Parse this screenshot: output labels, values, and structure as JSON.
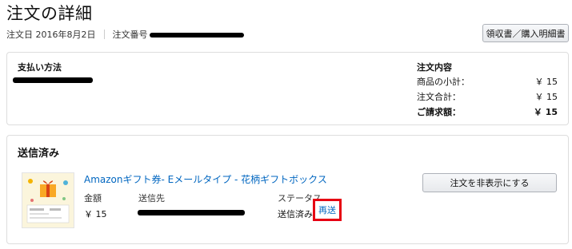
{
  "page": {
    "title": "注文の詳細",
    "order_date": "注文日 2016年8月2日",
    "order_number_label": "注文番号"
  },
  "buttons": {
    "receipt": "領収書／購入明細書",
    "hide_order": "注文を非表示にする",
    "resend": "再送"
  },
  "payment": {
    "heading": "支払い方法"
  },
  "summary": {
    "heading": "注文内容",
    "subtotal_label": "商品の小計：",
    "subtotal_value": "￥ 15",
    "total_label": "注文合計：",
    "total_value": "￥ 15",
    "billed_label": "ご請求額：",
    "billed_value": "￥ 15"
  },
  "shipment": {
    "status_heading": "送信済み",
    "item_title": "Amazonギフト券- Eメールタイプ - 花柄ギフトボックス",
    "amount_label": "金額",
    "amount_value": "￥ 15",
    "recipient_label": "送信先",
    "status_label": "ステータス",
    "status_value": "送信済み"
  },
  "colors": {
    "link": "#0066c0",
    "highlight": "#e60012"
  }
}
